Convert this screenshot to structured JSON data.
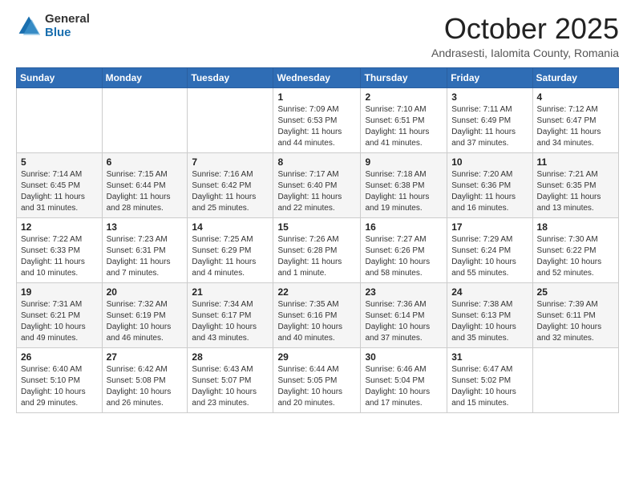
{
  "logo": {
    "general": "General",
    "blue": "Blue"
  },
  "header": {
    "title": "October 2025",
    "subtitle": "Andrasesti, Ialomita County, Romania"
  },
  "weekdays": [
    "Sunday",
    "Monday",
    "Tuesday",
    "Wednesday",
    "Thursday",
    "Friday",
    "Saturday"
  ],
  "weeks": [
    [
      {
        "day": "",
        "info": ""
      },
      {
        "day": "",
        "info": ""
      },
      {
        "day": "",
        "info": ""
      },
      {
        "day": "1",
        "info": "Sunrise: 7:09 AM\nSunset: 6:53 PM\nDaylight: 11 hours and 44 minutes."
      },
      {
        "day": "2",
        "info": "Sunrise: 7:10 AM\nSunset: 6:51 PM\nDaylight: 11 hours and 41 minutes."
      },
      {
        "day": "3",
        "info": "Sunrise: 7:11 AM\nSunset: 6:49 PM\nDaylight: 11 hours and 37 minutes."
      },
      {
        "day": "4",
        "info": "Sunrise: 7:12 AM\nSunset: 6:47 PM\nDaylight: 11 hours and 34 minutes."
      }
    ],
    [
      {
        "day": "5",
        "info": "Sunrise: 7:14 AM\nSunset: 6:45 PM\nDaylight: 11 hours and 31 minutes."
      },
      {
        "day": "6",
        "info": "Sunrise: 7:15 AM\nSunset: 6:44 PM\nDaylight: 11 hours and 28 minutes."
      },
      {
        "day": "7",
        "info": "Sunrise: 7:16 AM\nSunset: 6:42 PM\nDaylight: 11 hours and 25 minutes."
      },
      {
        "day": "8",
        "info": "Sunrise: 7:17 AM\nSunset: 6:40 PM\nDaylight: 11 hours and 22 minutes."
      },
      {
        "day": "9",
        "info": "Sunrise: 7:18 AM\nSunset: 6:38 PM\nDaylight: 11 hours and 19 minutes."
      },
      {
        "day": "10",
        "info": "Sunrise: 7:20 AM\nSunset: 6:36 PM\nDaylight: 11 hours and 16 minutes."
      },
      {
        "day": "11",
        "info": "Sunrise: 7:21 AM\nSunset: 6:35 PM\nDaylight: 11 hours and 13 minutes."
      }
    ],
    [
      {
        "day": "12",
        "info": "Sunrise: 7:22 AM\nSunset: 6:33 PM\nDaylight: 11 hours and 10 minutes."
      },
      {
        "day": "13",
        "info": "Sunrise: 7:23 AM\nSunset: 6:31 PM\nDaylight: 11 hours and 7 minutes."
      },
      {
        "day": "14",
        "info": "Sunrise: 7:25 AM\nSunset: 6:29 PM\nDaylight: 11 hours and 4 minutes."
      },
      {
        "day": "15",
        "info": "Sunrise: 7:26 AM\nSunset: 6:28 PM\nDaylight: 11 hours and 1 minute."
      },
      {
        "day": "16",
        "info": "Sunrise: 7:27 AM\nSunset: 6:26 PM\nDaylight: 10 hours and 58 minutes."
      },
      {
        "day": "17",
        "info": "Sunrise: 7:29 AM\nSunset: 6:24 PM\nDaylight: 10 hours and 55 minutes."
      },
      {
        "day": "18",
        "info": "Sunrise: 7:30 AM\nSunset: 6:22 PM\nDaylight: 10 hours and 52 minutes."
      }
    ],
    [
      {
        "day": "19",
        "info": "Sunrise: 7:31 AM\nSunset: 6:21 PM\nDaylight: 10 hours and 49 minutes."
      },
      {
        "day": "20",
        "info": "Sunrise: 7:32 AM\nSunset: 6:19 PM\nDaylight: 10 hours and 46 minutes."
      },
      {
        "day": "21",
        "info": "Sunrise: 7:34 AM\nSunset: 6:17 PM\nDaylight: 10 hours and 43 minutes."
      },
      {
        "day": "22",
        "info": "Sunrise: 7:35 AM\nSunset: 6:16 PM\nDaylight: 10 hours and 40 minutes."
      },
      {
        "day": "23",
        "info": "Sunrise: 7:36 AM\nSunset: 6:14 PM\nDaylight: 10 hours and 37 minutes."
      },
      {
        "day": "24",
        "info": "Sunrise: 7:38 AM\nSunset: 6:13 PM\nDaylight: 10 hours and 35 minutes."
      },
      {
        "day": "25",
        "info": "Sunrise: 7:39 AM\nSunset: 6:11 PM\nDaylight: 10 hours and 32 minutes."
      }
    ],
    [
      {
        "day": "26",
        "info": "Sunrise: 6:40 AM\nSunset: 5:10 PM\nDaylight: 10 hours and 29 minutes."
      },
      {
        "day": "27",
        "info": "Sunrise: 6:42 AM\nSunset: 5:08 PM\nDaylight: 10 hours and 26 minutes."
      },
      {
        "day": "28",
        "info": "Sunrise: 6:43 AM\nSunset: 5:07 PM\nDaylight: 10 hours and 23 minutes."
      },
      {
        "day": "29",
        "info": "Sunrise: 6:44 AM\nSunset: 5:05 PM\nDaylight: 10 hours and 20 minutes."
      },
      {
        "day": "30",
        "info": "Sunrise: 6:46 AM\nSunset: 5:04 PM\nDaylight: 10 hours and 17 minutes."
      },
      {
        "day": "31",
        "info": "Sunrise: 6:47 AM\nSunset: 5:02 PM\nDaylight: 10 hours and 15 minutes."
      },
      {
        "day": "",
        "info": ""
      }
    ]
  ]
}
